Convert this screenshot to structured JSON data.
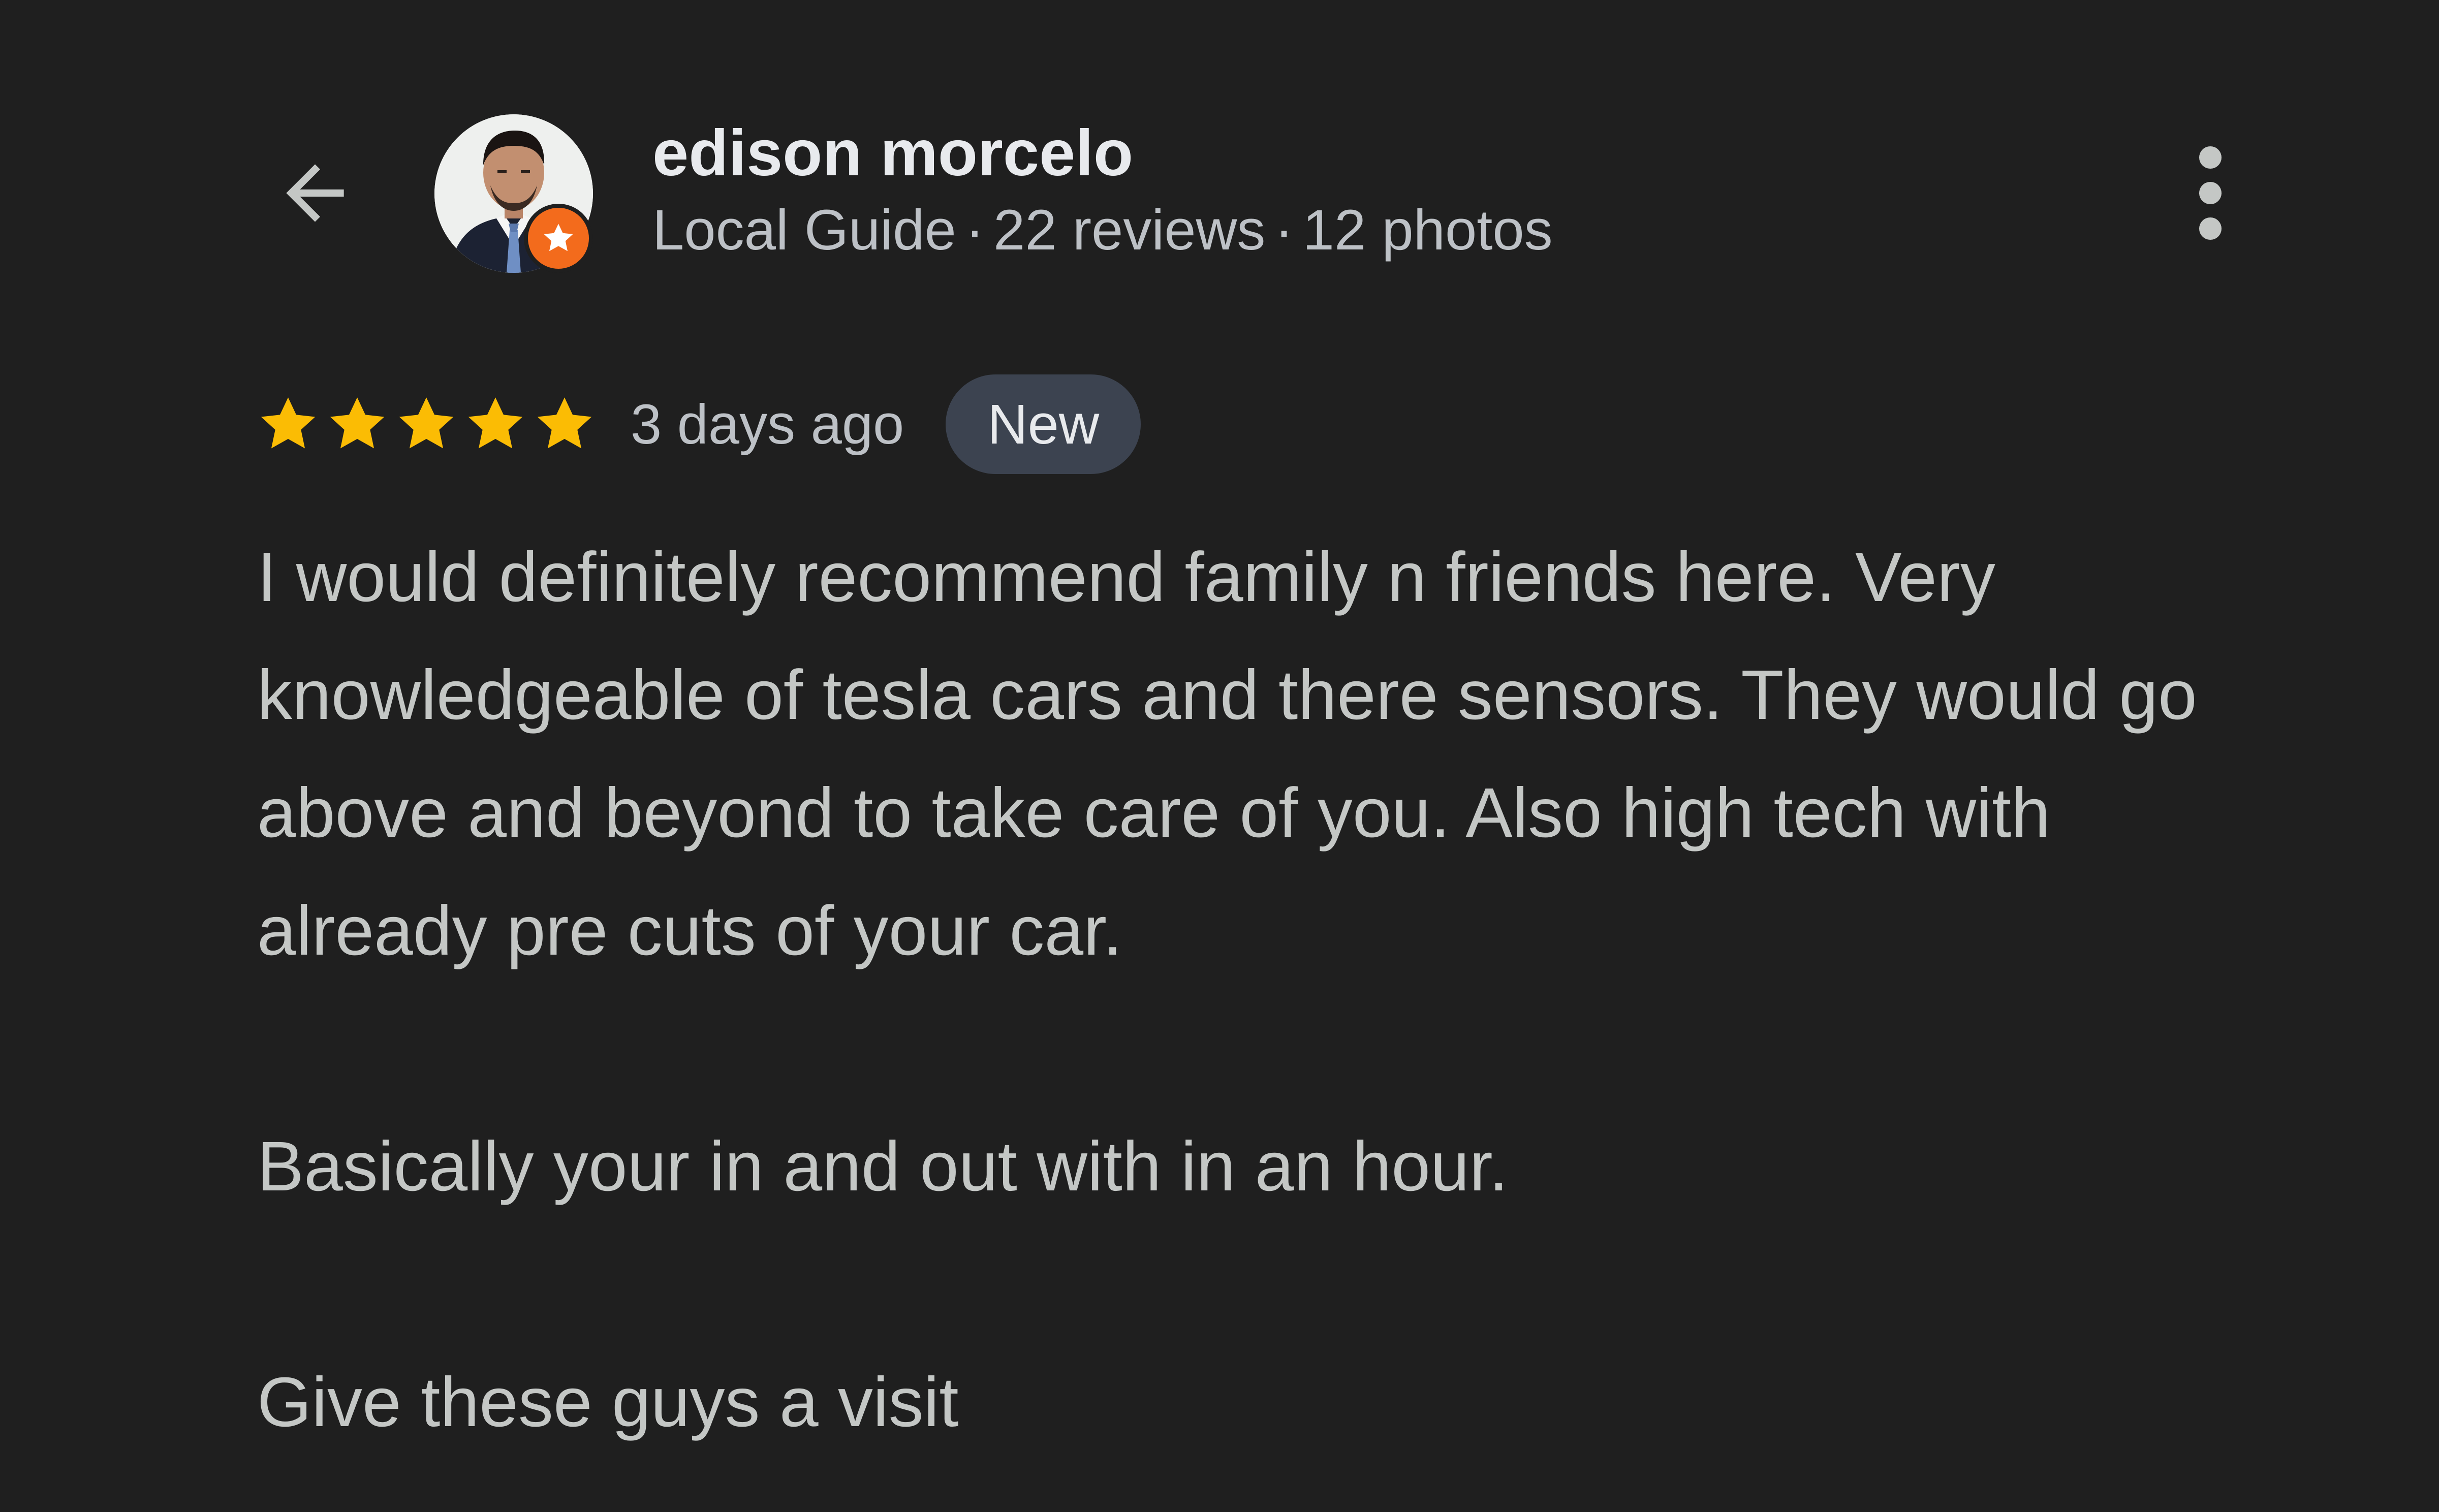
{
  "header": {
    "back_icon": "arrow-left-icon",
    "user_name": "edison morcelo",
    "meta": {
      "guide_label": "Local Guide",
      "reviews": "22 reviews",
      "photos": "12 photos",
      "separator": "·"
    },
    "badge_icon": "local-guide-star-icon",
    "more_icon": "more-vert-icon",
    "badge_color": "#f36b1c"
  },
  "review": {
    "rating": 5,
    "rating_max": 5,
    "star_color": "#fbbc04",
    "date": "3 days ago",
    "badge": "New",
    "paragraphs": [
      "I would definitely recommend family n friends here. Very knowledgeable of tesla cars and there sensors. They would go above and beyond to take care of you. Also high tech with already pre cuts of your car.",
      "Basically your in and out with in an hour.",
      "Give these guys a visit"
    ]
  }
}
